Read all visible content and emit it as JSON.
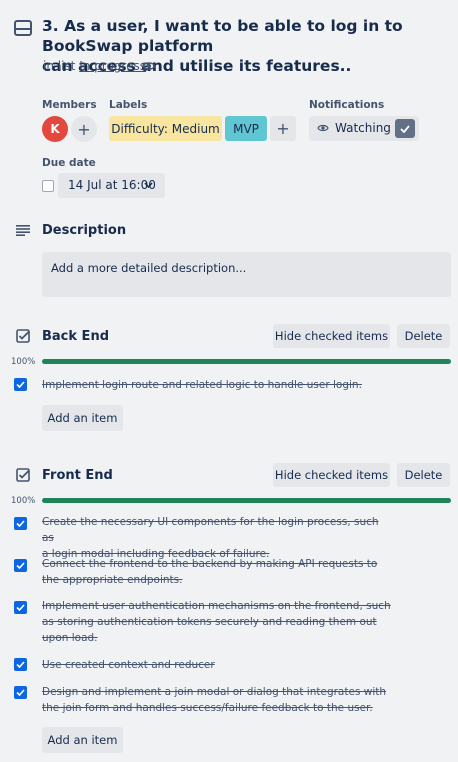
{
  "card": {
    "title": "3. As a user, I want to be able to log in to BookSwap platform\ncan access and utilise its features..",
    "in_list_prefix": "in list",
    "list_name": "In progress"
  },
  "members": {
    "label": "Members",
    "avatar_initial": "K",
    "add_symbol": "+"
  },
  "labels": {
    "label": "Labels",
    "items": [
      {
        "text": "Difficulty: Medium",
        "color": "#f8e6a0"
      },
      {
        "text": "MVP",
        "color": "#60c6d2"
      }
    ],
    "add_symbol": "+"
  },
  "notifications": {
    "label": "Notifications",
    "watch_label": "Watching"
  },
  "due_date": {
    "label": "Due date",
    "value": "14 Jul at 16:00"
  },
  "description": {
    "title": "Description",
    "placeholder": "Add a more detailed description..."
  },
  "checklists": [
    {
      "title": "Back End",
      "hide_label": "Hide checked items",
      "delete_label": "Delete",
      "percent_label": "100%",
      "progress": 100,
      "add_label": "Add an item",
      "items": [
        {
          "text": "Implement login route and related logic to handle user login.",
          "checked": true
        }
      ]
    },
    {
      "title": "Front End",
      "hide_label": "Hide checked items",
      "delete_label": "Delete",
      "percent_label": "100%",
      "progress": 100,
      "add_label": "Add an item",
      "items": [
        {
          "text": "Create the necessary UI components for the login process, such as\na login modal including feedback of failure.",
          "checked": true
        },
        {
          "text": "Connect the frontend to the backend by making API requests to\nthe appropriate endpoints.",
          "checked": true
        },
        {
          "text": "Implement user authentication mechanisms on the frontend, such\nas storing authentication tokens securely and reading them out\nupon load.",
          "checked": true
        },
        {
          "text": "Use created context and reducer",
          "checked": true
        },
        {
          "text": "Design and implement a join modal or dialog that integrates with\nthe join form and handles success/failure feedback to the user.",
          "checked": true
        }
      ]
    }
  ],
  "colors": {
    "accent": "#0c66e4",
    "progress": "#1f845a",
    "avatar": "#e2483d"
  }
}
